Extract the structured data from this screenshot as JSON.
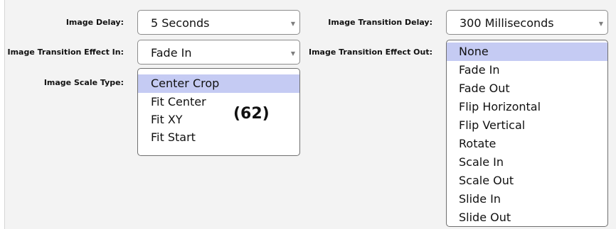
{
  "labels": {
    "image_delay": "Image Delay:",
    "transition_delay": "Image Transition Delay:",
    "effect_in": "Image Transition Effect In:",
    "effect_out": "Image Transition Effect Out:",
    "scale_type": "Image Scale Type:"
  },
  "image_delay": {
    "value": "5 Seconds"
  },
  "transition_delay": {
    "value": "300 Milliseconds"
  },
  "effect_in": {
    "value": "Fade In"
  },
  "scale_type": {
    "options": [
      "Center Crop",
      "Fit Center",
      "Fit XY",
      "Fit Start"
    ],
    "selected": "Center Crop"
  },
  "effect_out": {
    "options": [
      "None",
      "Fade In",
      "Fade Out",
      "Flip Horizontal",
      "Flip Vertical",
      "Rotate",
      "Scale In",
      "Scale Out",
      "Slide In",
      "Slide Out"
    ],
    "selected": "None"
  },
  "badge": "(62)",
  "icons": {
    "dropdown": "chevron-down-icon"
  },
  "colors": {
    "selection": "#c5cbf3",
    "panel": "#f3f3f3"
  }
}
